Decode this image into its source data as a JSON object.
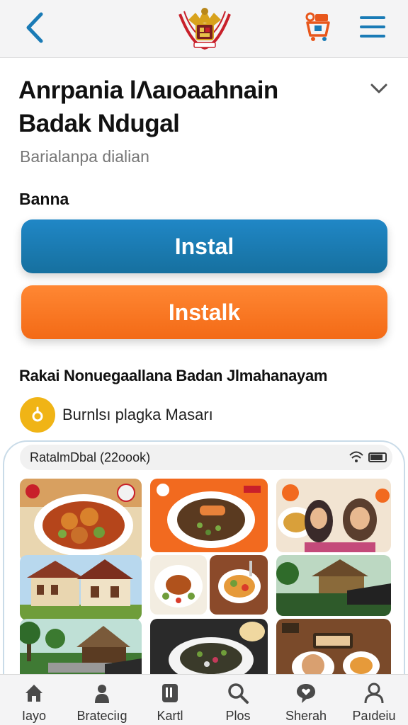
{
  "header": {
    "back_icon": "chevron-left-icon",
    "emblem": "garuda-emblem",
    "cart_icon": "cart-icon",
    "menu_icon": "hamburger-menu-icon"
  },
  "title": "Anrpania lΛaıoaahnain Badak Ndugal",
  "subtitle": "Barialanpa dialian",
  "section_label": "Banna",
  "buttons": {
    "primary": "Instal",
    "secondary": "Instalk"
  },
  "agency": {
    "name": "Rakai Nonuegaallana Badan Jlmahanayam",
    "badge_text": "Burnlsı plagka Masarı"
  },
  "preview": {
    "status_text": "RatalmDbal (22oook)"
  },
  "tabs": [
    {
      "label": "Iayo",
      "icon": "home-icon"
    },
    {
      "label": "Brateciıg",
      "icon": "person-icon"
    },
    {
      "label": "Kartl",
      "icon": "card-icon"
    },
    {
      "label": "Plos",
      "icon": "search-icon"
    },
    {
      "label": "Sherah",
      "icon": "chat-heart-icon"
    },
    {
      "label": "Paıdeiu",
      "icon": "profile-icon"
    }
  ],
  "colors": {
    "accent_blue": "#1a7bb6",
    "accent_orange": "#f77a22",
    "badge_yellow": "#f0b416"
  }
}
